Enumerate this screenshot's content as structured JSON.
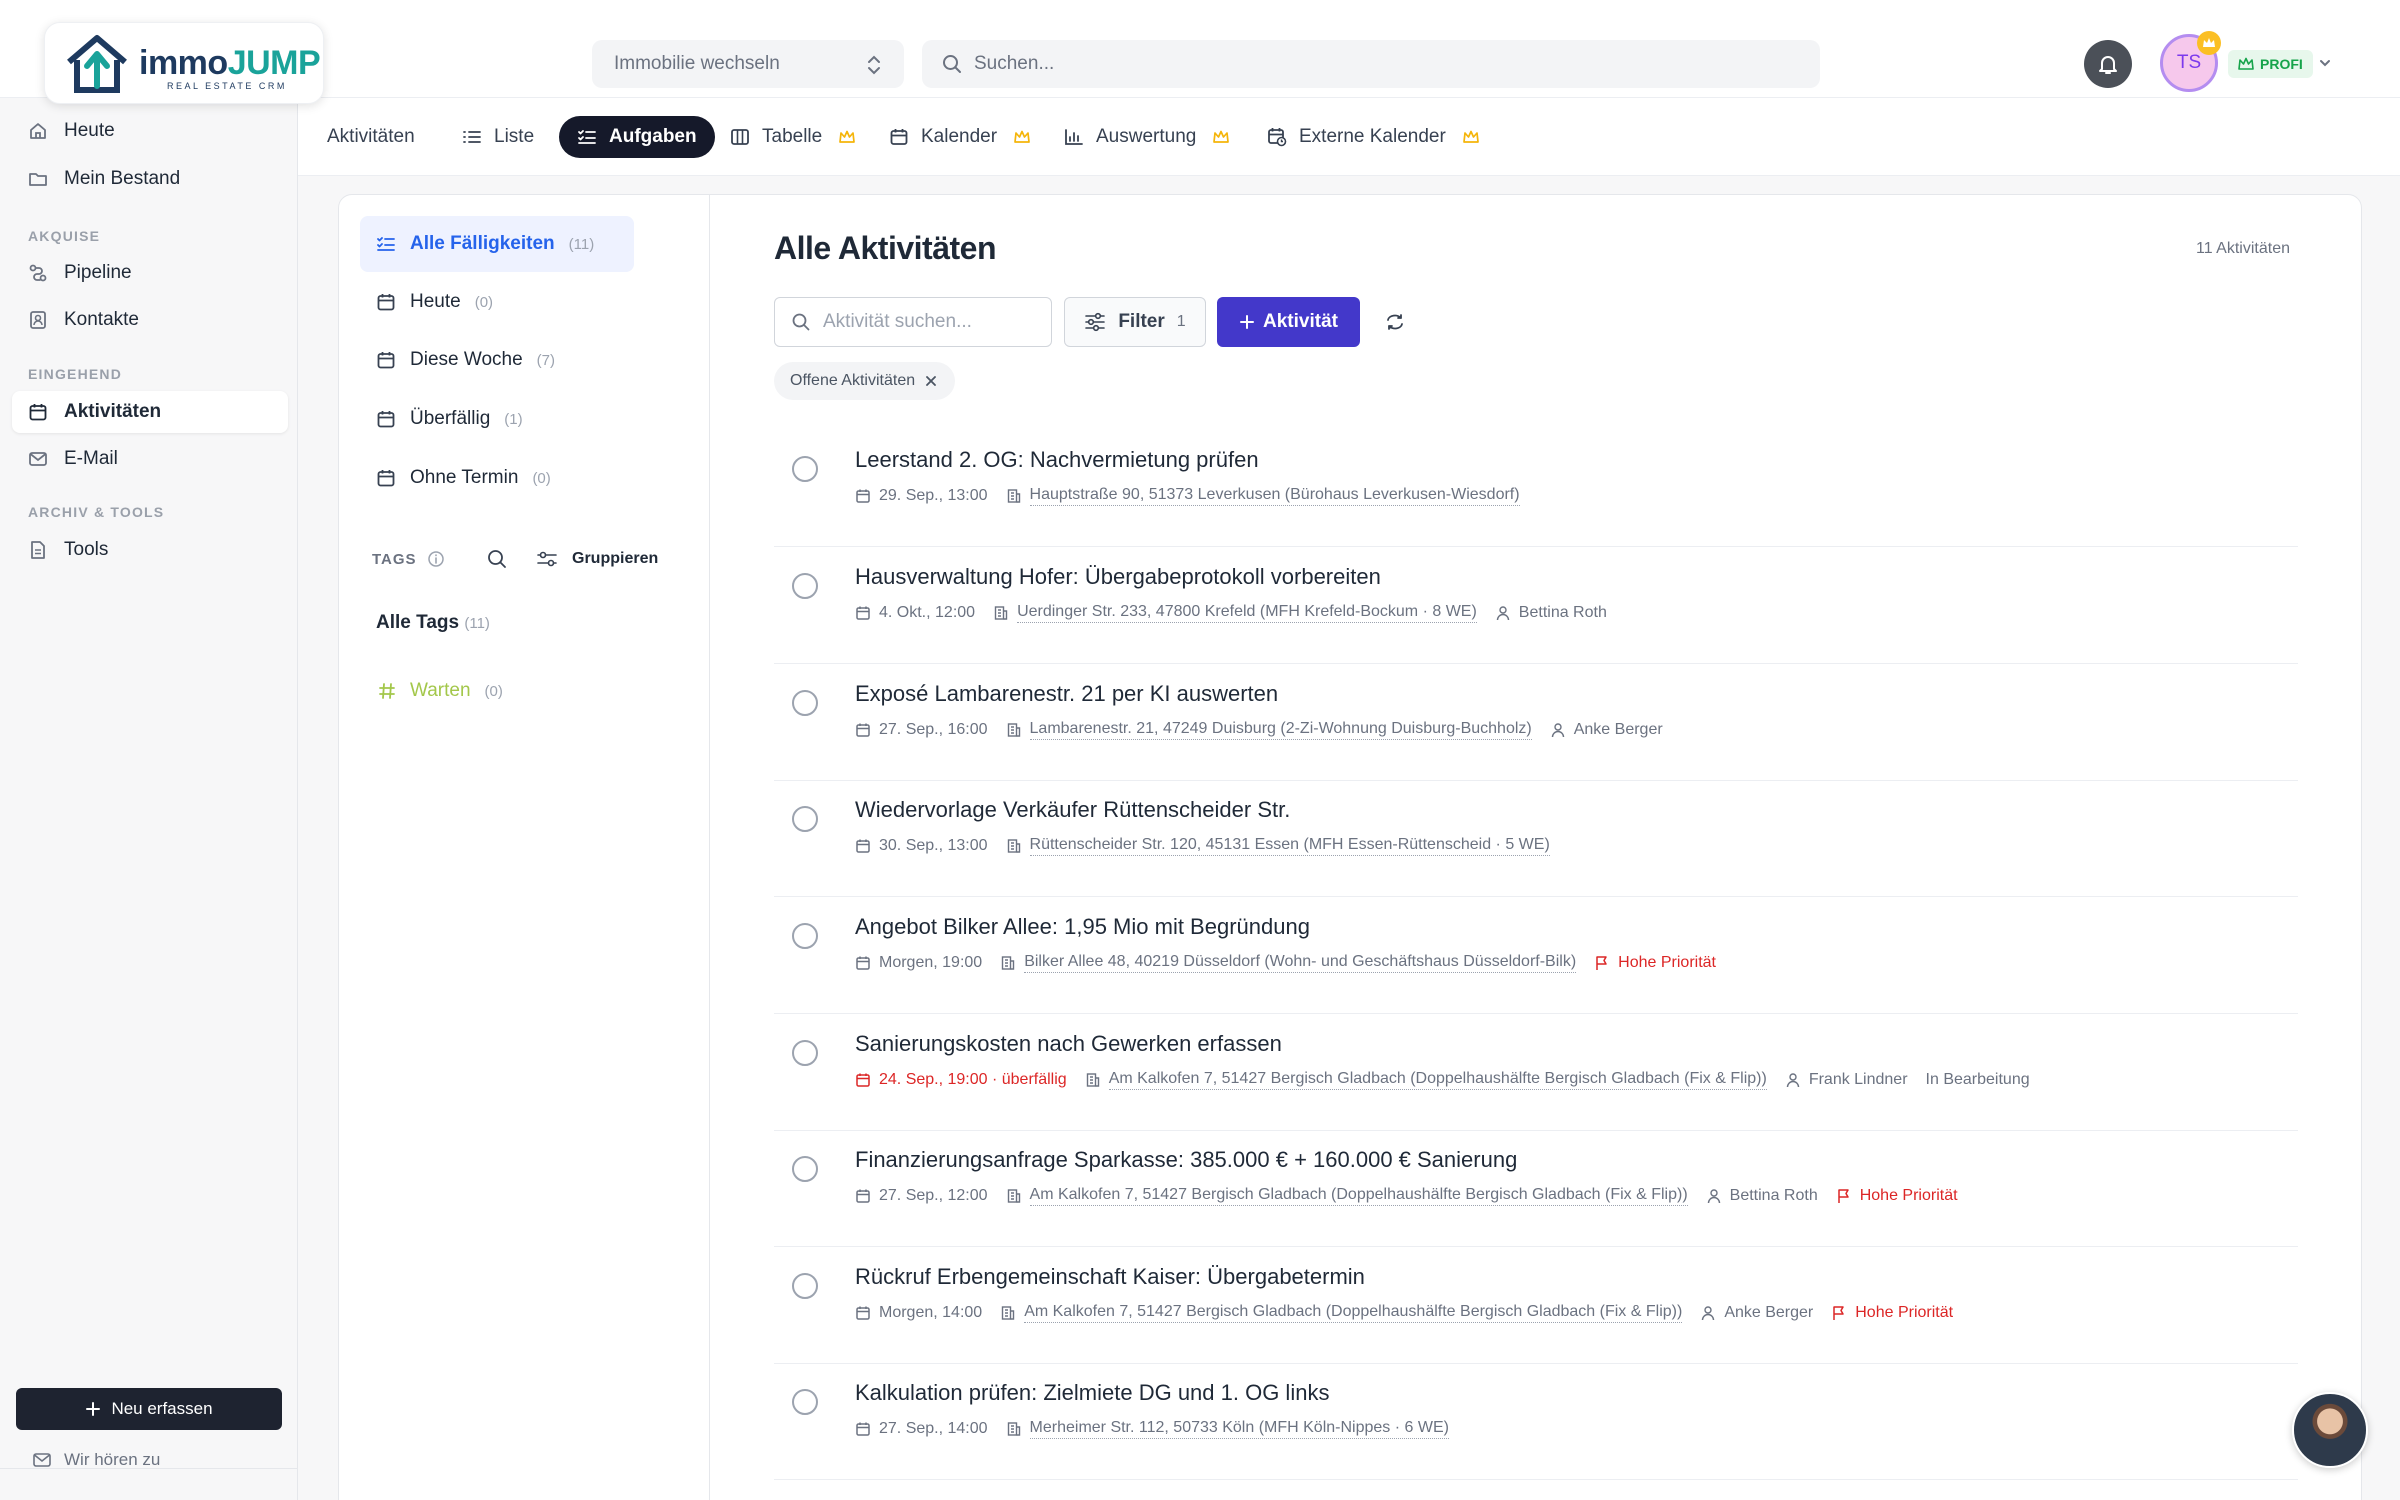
{
  "header": {
    "logo_word_1": "immo",
    "logo_word_2": "JUMP",
    "logo_sub": "REAL ESTATE CRM",
    "property_switch": "Immobilie wechseln",
    "search_placeholder": "Suchen...",
    "avatar_initials": "TS",
    "plan_badge": "PROFI"
  },
  "sidebar": {
    "items_top": [
      {
        "label": "Heute",
        "icon": "home-icon"
      },
      {
        "label": "Mein Bestand",
        "icon": "folder-icon"
      }
    ],
    "section_akquise": "AKQUISE",
    "items_akquise": [
      {
        "label": "Pipeline",
        "icon": "pipeline-icon"
      },
      {
        "label": "Kontakte",
        "icon": "contact-icon"
      }
    ],
    "section_eingehend": "EINGEHEND",
    "items_eingehend": [
      {
        "label": "Aktivitäten",
        "icon": "calendar-icon"
      },
      {
        "label": "E-Mail",
        "icon": "mail-icon"
      }
    ],
    "section_archiv": "ARCHIV & TOOLS",
    "items_archiv": [
      {
        "label": "Tools",
        "icon": "document-icon"
      }
    ],
    "new_button": "Neu erfassen",
    "feedback": "Wir hören zu"
  },
  "tabs": {
    "heading": "Aktivitäten",
    "items": [
      "Liste",
      "Aufgaben",
      "Tabelle",
      "Kalender",
      "Auswertung",
      "Externe Kalender"
    ]
  },
  "filters": {
    "items": [
      {
        "label": "Alle Fälligkeiten",
        "count": "(11)"
      },
      {
        "label": "Heute",
        "count": "(0)"
      },
      {
        "label": "Diese Woche",
        "count": "(7)"
      },
      {
        "label": "Überfällig",
        "count": "(1)"
      },
      {
        "label": "Ohne Termin",
        "count": "(0)"
      }
    ],
    "tags_heading": "TAGS",
    "group_label": "Gruppieren",
    "all_tags": "Alle Tags",
    "all_tags_count": "(11)",
    "tag_warten": "Warten",
    "tag_warten_count": "(0)"
  },
  "main": {
    "title": "Alle Aktivitäten",
    "count": "11 Aktivitäten",
    "search_placeholder": "Aktivität suchen...",
    "filter_label": "Filter",
    "filter_count": "1",
    "add_label": "Aktivität",
    "chip_label": "Offene Aktivitäten",
    "activities": [
      {
        "title": "Leerstand 2. OG: Nachvermietung prüfen",
        "date": "29. Sep., 13:00",
        "address": "Hauptstraße 90, 51373 Leverkusen (Bürohaus Leverkusen-Wiesdorf)"
      },
      {
        "title": "Hausverwaltung Hofer: Übergabeprotokoll vorbereiten",
        "date": "4. Okt., 12:00",
        "address": "Uerdinger Str. 233, 47800 Krefeld (MFH Krefeld-Bockum · 8 WE)",
        "person": "Bettina Roth"
      },
      {
        "title": "Exposé Lambarenestr. 21 per KI auswerten",
        "date": "27. Sep., 16:00",
        "address": "Lambarenestr. 21, 47249 Duisburg (2-Zi-Wohnung Duisburg-Buchholz)",
        "person": "Anke Berger"
      },
      {
        "title": "Wiedervorlage Verkäufer Rüttenscheider Str.",
        "date": "30. Sep., 13:00",
        "address": "Rüttenscheider Str. 120, 45131 Essen (MFH Essen-Rüttenscheid · 5 WE)"
      },
      {
        "title": "Angebot Bilker Allee: 1,95 Mio mit Begründung",
        "date": "Morgen, 19:00",
        "address": "Bilker Allee 48, 40219 Düsseldorf (Wohn- und Geschäftshaus Düsseldorf-Bilk)",
        "priority": "Hohe Priorität"
      },
      {
        "title": "Sanierungskosten nach Gewerken erfassen",
        "date": "24. Sep., 19:00 · überfällig",
        "overdue": true,
        "address": "Am Kalkofen 7, 51427 Bergisch Gladbach (Doppelhaushälfte Bergisch Gladbach (Fix & Flip))",
        "person": "Frank Lindner",
        "status": "In Bearbeitung"
      },
      {
        "title": "Finanzierungsanfrage Sparkasse: 385.000 € + 160.000 € Sanierung",
        "date": "27. Sep., 12:00",
        "address": "Am Kalkofen 7, 51427 Bergisch Gladbach (Doppelhaushälfte Bergisch Gladbach (Fix & Flip))",
        "person": "Bettina Roth",
        "priority": "Hohe Priorität"
      },
      {
        "title": "Rückruf Erbengemeinschaft Kaiser: Übergabetermin",
        "date": "Morgen, 14:00",
        "address": "Am Kalkofen 7, 51427 Bergisch Gladbach (Doppelhaushälfte Bergisch Gladbach (Fix & Flip))",
        "person": "Anke Berger",
        "priority": "Hohe Priorität"
      },
      {
        "title": "Kalkulation prüfen: Zielmiete DG und 1. OG links",
        "date": "27. Sep., 14:00",
        "address": "Merheimer Str. 112, 50733 Köln (MFH Köln-Nippes · 6 WE)"
      }
    ]
  },
  "colors": {
    "accent": "#4338ca",
    "active_tab": "#15192a",
    "priority": "#dc2626",
    "brand_teal": "#1aa39a",
    "brand_navy": "#1e3a5f"
  }
}
